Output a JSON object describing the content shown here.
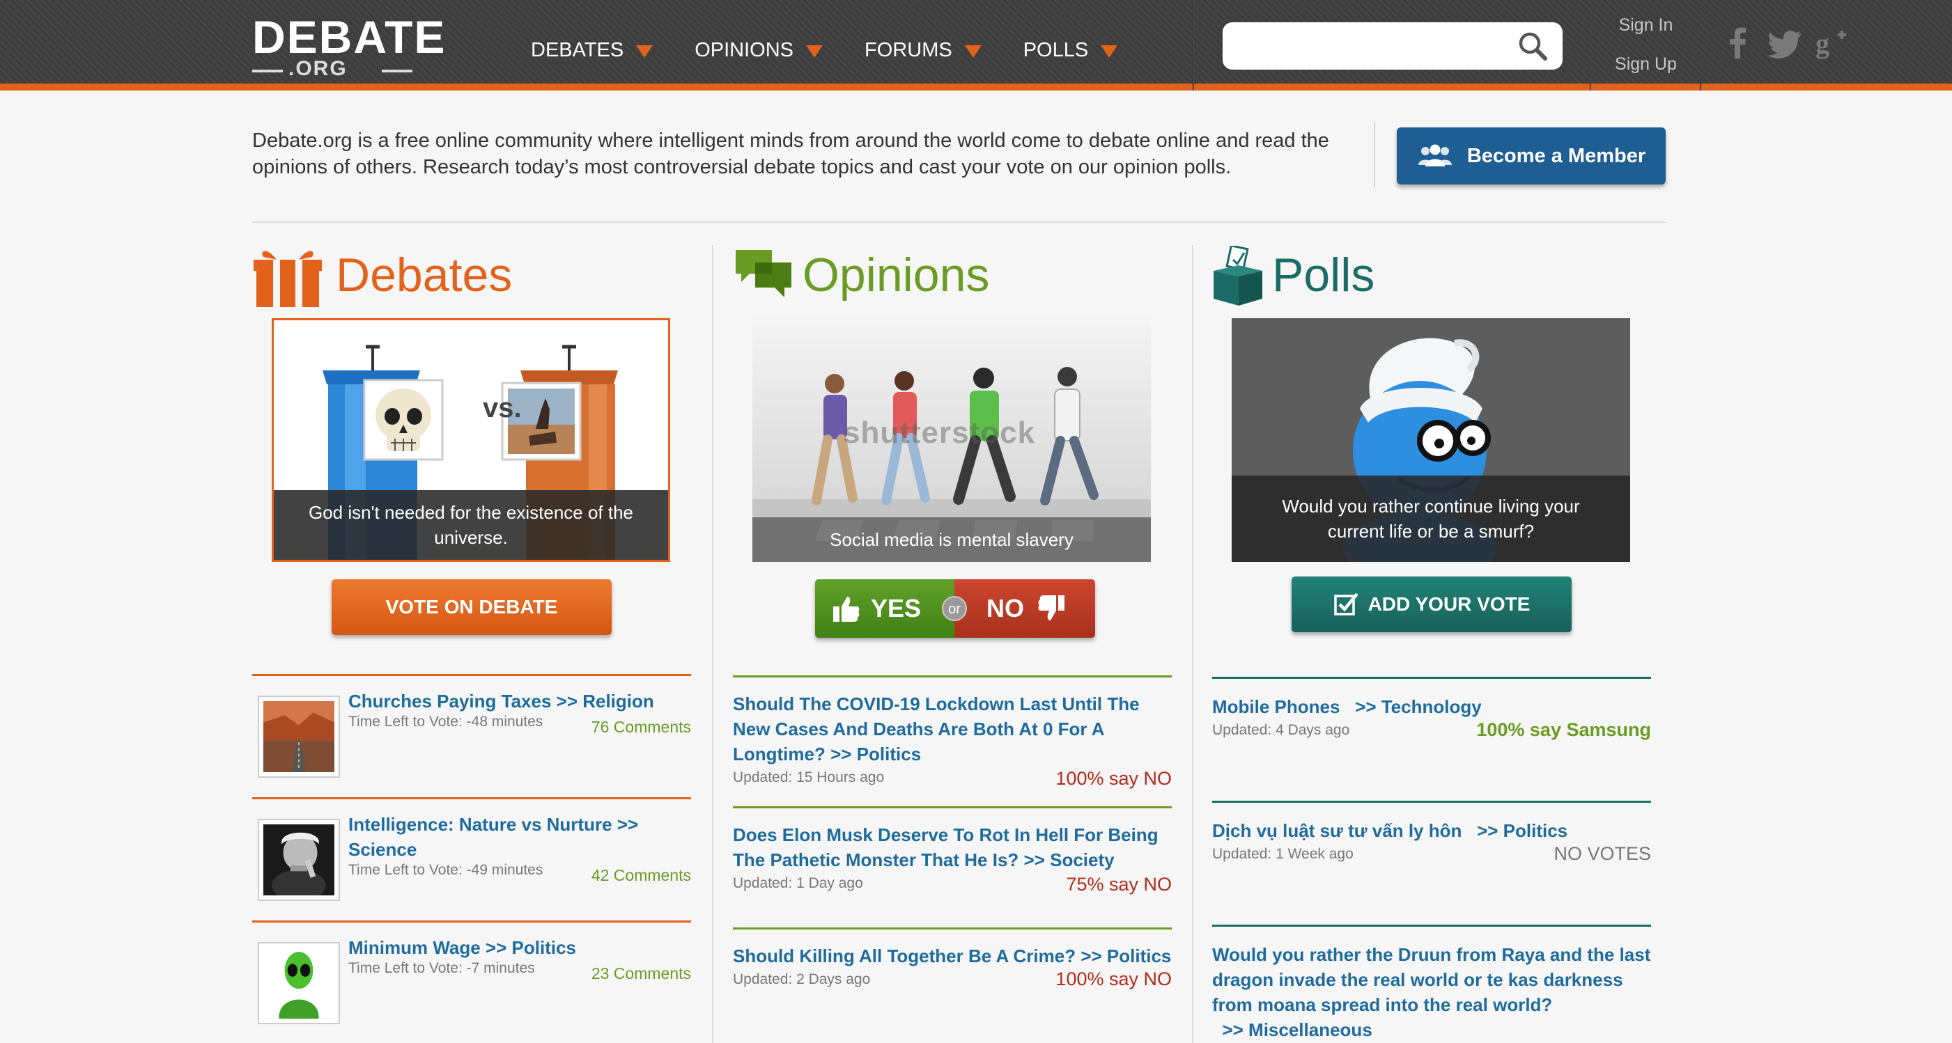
{
  "header": {
    "logo": {
      "main": "DEBATE",
      "sub": ".ORG"
    },
    "nav": [
      {
        "label": "DEBATES"
      },
      {
        "label": "OPINIONS"
      },
      {
        "label": "FORUMS"
      },
      {
        "label": "POLLS"
      }
    ],
    "search": {
      "placeholder": ""
    },
    "sign_in": "Sign In",
    "sign_up": "Sign Up"
  },
  "intro": {
    "text": "Debate.org is a free online community where intelligent minds from around the world come to debate online and read the opinions of others. Research today’s most controversial debate topics and cast your vote on our opinion polls.",
    "member_button": "Become a Member"
  },
  "debates": {
    "title": "Debates",
    "featured": {
      "vs": "vs.",
      "caption": "God isn't needed for the existence of the universe."
    },
    "button": "VOTE ON DEBATE",
    "items": [
      {
        "title": "Churches Paying Taxes >> Religion",
        "meta": "Time Left to Vote: -48 minutes",
        "comments": "76 Comments"
      },
      {
        "title": "Intelligence: Nature vs Nurture >> Science",
        "meta": "Time Left to Vote: -49 minutes",
        "comments": "42 Comments"
      },
      {
        "title": "Minimum Wage >> Politics",
        "meta": "Time Left to Vote: -7 minutes",
        "comments": "23 Comments"
      }
    ]
  },
  "opinions": {
    "title": "Opinions",
    "featured": {
      "watermark": "shutterstock",
      "caption": "Social media is mental slavery"
    },
    "yes": "YES",
    "or": "or",
    "no": "NO",
    "items": [
      {
        "title": "Should The COVID-19 Lockdown Last Until The New Cases And Deaths Are Both At 0 For A Longtime?",
        "category": ">> Politics",
        "meta": "Updated: 15 Hours ago",
        "result": "100% say NO"
      },
      {
        "title": "Does Elon Musk Deserve To Rot In Hell For Being The Pathetic Monster That He Is?",
        "category": ">> Society",
        "meta": "Updated: 1 Day ago",
        "result": "75% say NO"
      },
      {
        "title": "Should Killing All Together Be A Crime?",
        "category": ">> Politics",
        "meta": "Updated: 2 Days ago",
        "result": "100% say NO"
      }
    ]
  },
  "polls": {
    "title": "Polls",
    "featured": {
      "caption": "Would you rather continue living your current life or be a smurf?"
    },
    "button": "ADD YOUR VOTE",
    "items": [
      {
        "title": "Mobile Phones",
        "category": ">> Technology",
        "meta": "Updated: 4 Days ago",
        "result": "100% say Samsung"
      },
      {
        "title": "Dịch vụ luật sư tư vấn ly hôn",
        "category": ">> Politics",
        "meta": "Updated: 1 Week ago",
        "result": "NO VOTES"
      },
      {
        "title": "Would you rather the Druun from Raya and the last dragon invade the real world or te kas darkness from moana spread into the real world?",
        "category": ">> Miscellaneous",
        "meta": "",
        "result": ""
      }
    ]
  },
  "colors": {
    "orange": "#e2621b",
    "green": "#6a9b23",
    "teal": "#1b6c66",
    "link": "#1f6b9c",
    "red": "#b12d1c",
    "header_bg": "#3d3d3d"
  },
  "icons": [
    "search-icon",
    "facebook-icon",
    "twitter-icon",
    "google-plus-icon",
    "members-icon",
    "gift-icon",
    "speech-bubbles-icon",
    "ballot-box-icon",
    "thumbs-up-icon",
    "thumbs-down-icon",
    "checkbox-icon"
  ]
}
